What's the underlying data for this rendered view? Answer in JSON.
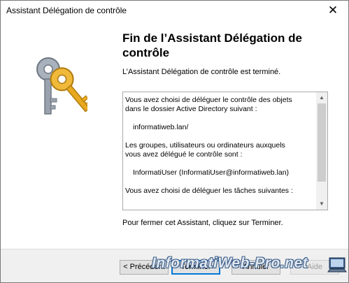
{
  "window": {
    "title": "Assistant Délégation de contrôle",
    "close_glyph": "✕"
  },
  "content": {
    "heading": "Fin de l’Assistant Délégation de contrôle",
    "done_text": "L’Assistant Délégation de contrôle est terminé.",
    "summary": {
      "line1": "Vous avez choisi de déléguer le contrôle des objets",
      "line2": "dans le dossier Active Directory suivant :",
      "folder": "informatiweb.lan/",
      "line3": "Les groupes, utilisateurs ou ordinateurs auxquels",
      "line4": "vous avez délégué le contrôle sont :",
      "user": "InformatiUser (InformatiUser@informatiweb.lan)",
      "line5": "Vous avez choisi de déléguer les tâches suivantes :"
    },
    "close_hint": "Pour fermer cet Assistant, cliquez sur Terminer."
  },
  "buttons": {
    "previous": "< Précédent",
    "finish": "Terminer",
    "cancel": "Annuler",
    "help": "Aide"
  },
  "watermark": "InformatiWeb-Pro.net",
  "icons": [
    "keys-icon",
    "scroll-up-icon",
    "scroll-down-icon",
    "computer-icon"
  ]
}
